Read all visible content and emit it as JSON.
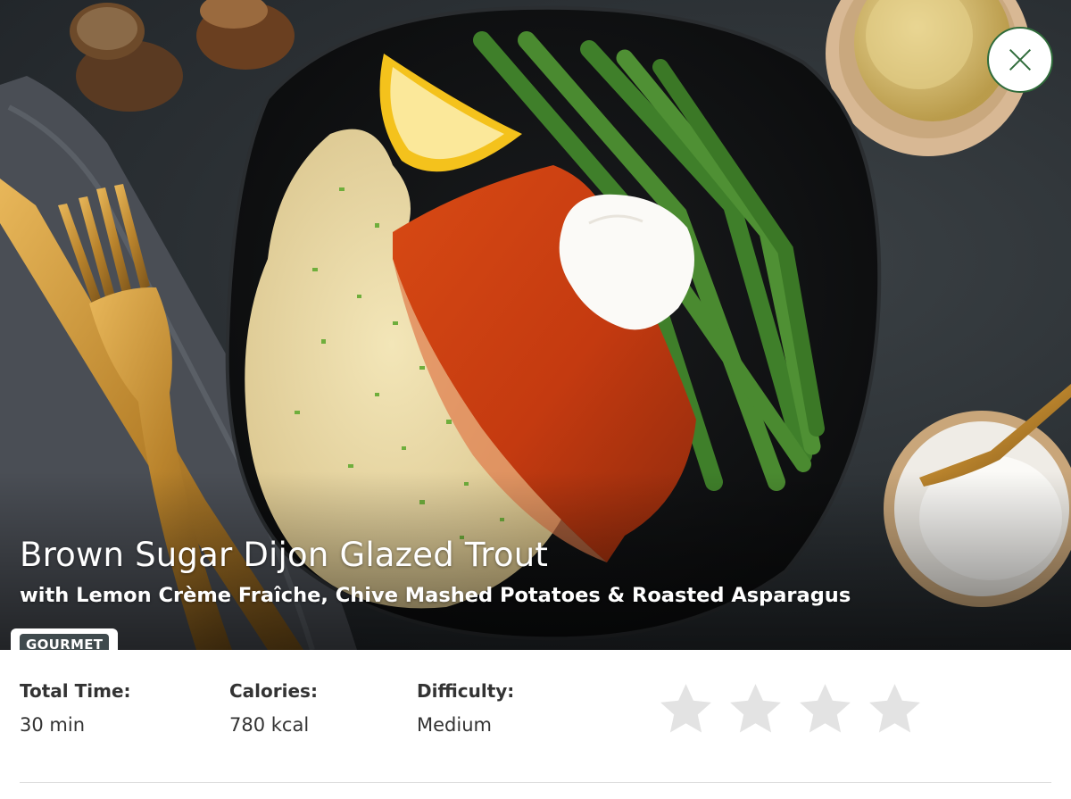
{
  "recipe": {
    "title": "Brown Sugar Dijon Glazed Trout",
    "subtitle": "with Lemon Crème Fraîche, Chive Mashed Potatoes & Roasted Asparagus",
    "badge": "GOURMET"
  },
  "stats": [
    {
      "label": "Total Time:",
      "value": "30 min"
    },
    {
      "label": "Calories:",
      "value": "780 kcal"
    },
    {
      "label": "Difficulty:",
      "value": "Medium"
    }
  ],
  "rating": {
    "max": 4,
    "value": 0,
    "empty_color": "#e3e3e3",
    "filled_color": "#f5b301"
  },
  "icons": {
    "close": "close-icon",
    "star": "star-icon"
  },
  "colors": {
    "accent": "#2f6b3a",
    "badge": "#3f4a4d"
  }
}
